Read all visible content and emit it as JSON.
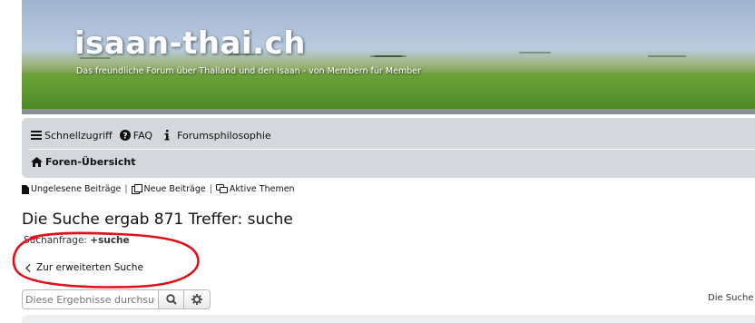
{
  "header": {
    "site_title": "isaan-thai.ch",
    "site_subtitle": "Das freundliche Forum über Thailand und den Isaan - von Membern für Member"
  },
  "nav": {
    "quick_access": "Schnellzugriff",
    "faq": "FAQ",
    "philosophy": "Forumsphilosophie",
    "forum_index": "Foren-Übersicht"
  },
  "quicklinks": {
    "unread": "Ungelesene Beiträge",
    "new": "Neue Beiträge",
    "active": "Aktive Themen",
    "separator": "|"
  },
  "search": {
    "title_prefix": "Die Suche ergab 871 Treffer:",
    "title_keyword": "suche",
    "query_label": "Suchanfrage:",
    "query_value": "+suche",
    "back_link": "Zur erweiterten Suche",
    "filter_placeholder": "Diese Ergebnisse durchsuchen",
    "right_text": "Die Suche"
  },
  "colors": {
    "navbar_bg": "#d4d8dc",
    "annotation_red": "#e0101a"
  }
}
